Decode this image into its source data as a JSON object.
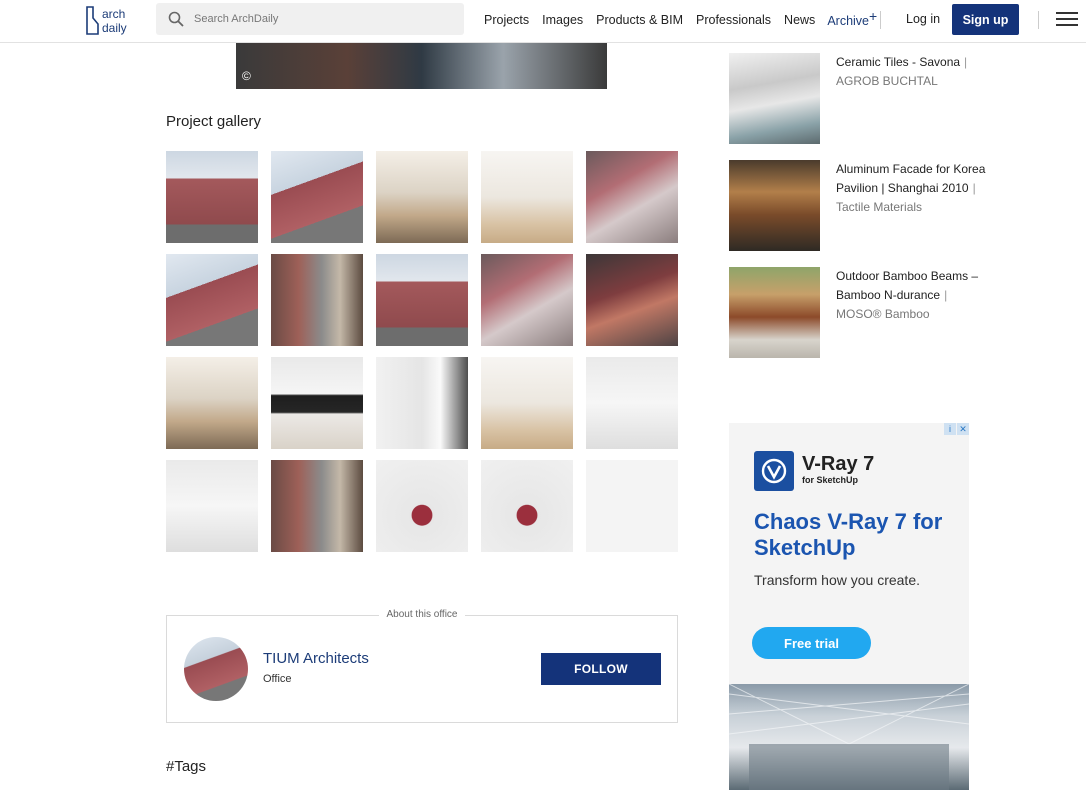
{
  "header": {
    "logo_line1": "arch",
    "logo_line2": "daily",
    "search_placeholder": "Search ArchDaily",
    "nav": [
      "Projects",
      "Images",
      "Products & BIM",
      "Professionals",
      "News"
    ],
    "archive_label": "Archive",
    "archive_suffix": "+",
    "login_label": "Log in",
    "signup_label": "Sign up",
    "brand_color": "#14337a"
  },
  "top_image": {
    "copyright": "©"
  },
  "gallery": {
    "title": "Project gallery",
    "thumb_styles": [
      "t-brick",
      "t-brick2",
      "t-int",
      "t-stair",
      "t-dark",
      "t-brick2",
      "t-alley",
      "t-brick",
      "t-dark",
      "t-night",
      "t-int",
      "t-tv",
      "t-kitchen",
      "t-stair",
      "t-white",
      "t-white",
      "t-alley",
      "t-model",
      "t-model",
      "t-sketch"
    ]
  },
  "office": {
    "section_label": "About this office",
    "name": "TIUM Architects",
    "type": "Office",
    "follow_label": "FOLLOW"
  },
  "tags_title": "#Tags",
  "sidebar": {
    "items": [
      {
        "title": "Ceramic Tiles - Savona",
        "brand": "AGROB BUCHTAL"
      },
      {
        "title": "Aluminum Facade for Korea Pavilion | Shanghai 2010",
        "brand": "Tactile Materials"
      },
      {
        "title": "Outdoor Bamboo Beams – Bamboo N-durance",
        "brand": "MOSO® Bamboo"
      }
    ]
  },
  "ad": {
    "product_title": "V-Ray 7",
    "product_sub": "for SketchUp",
    "headline": "Chaos V-Ray 7 for SketchUp",
    "body": "Transform how you create.",
    "cta": "Free trial",
    "accent": "#21a8f0"
  }
}
